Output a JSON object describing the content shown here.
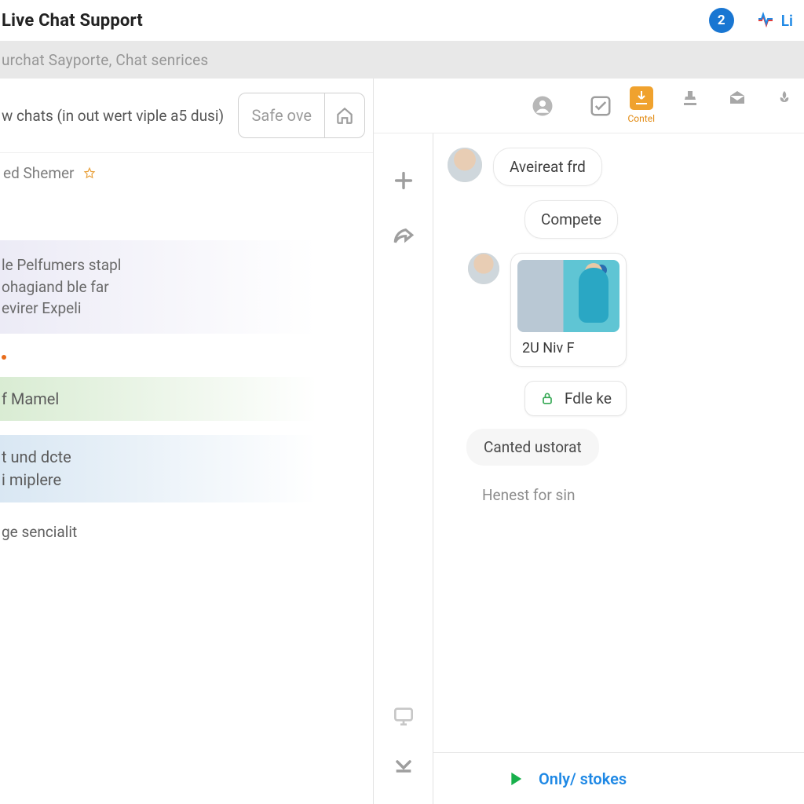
{
  "header": {
    "title": "Live Chat Support",
    "badge_count": "2",
    "right_link": "Li"
  },
  "subheader": {
    "text": "urchat Sayporte, Chat senrices"
  },
  "left": {
    "top_text": "w chats (in out wert viple a5 dusi)",
    "safe_label": "Safe ove",
    "shemer": "ed Shemer",
    "item_pale_l1": "le Pelfumers stapl",
    "item_pale_l2": "ohagiand ble far",
    "item_pale_l3": "evirer Expeli",
    "item_green": "f Mamel",
    "item_blue_l1": "t und dcte",
    "item_blue_l2": "i miplere",
    "item_plain": "ge sencialit"
  },
  "right_tabs": {
    "active_label": "Contel"
  },
  "chat": {
    "m1": "Aveireat frd",
    "m2": "Compete",
    "card_caption": "2U Niv F",
    "lock": "Fdle ke",
    "m3": "Canted ustorat",
    "typing": "Henest for sin"
  },
  "footer": {
    "text": "Only/ stokes"
  }
}
